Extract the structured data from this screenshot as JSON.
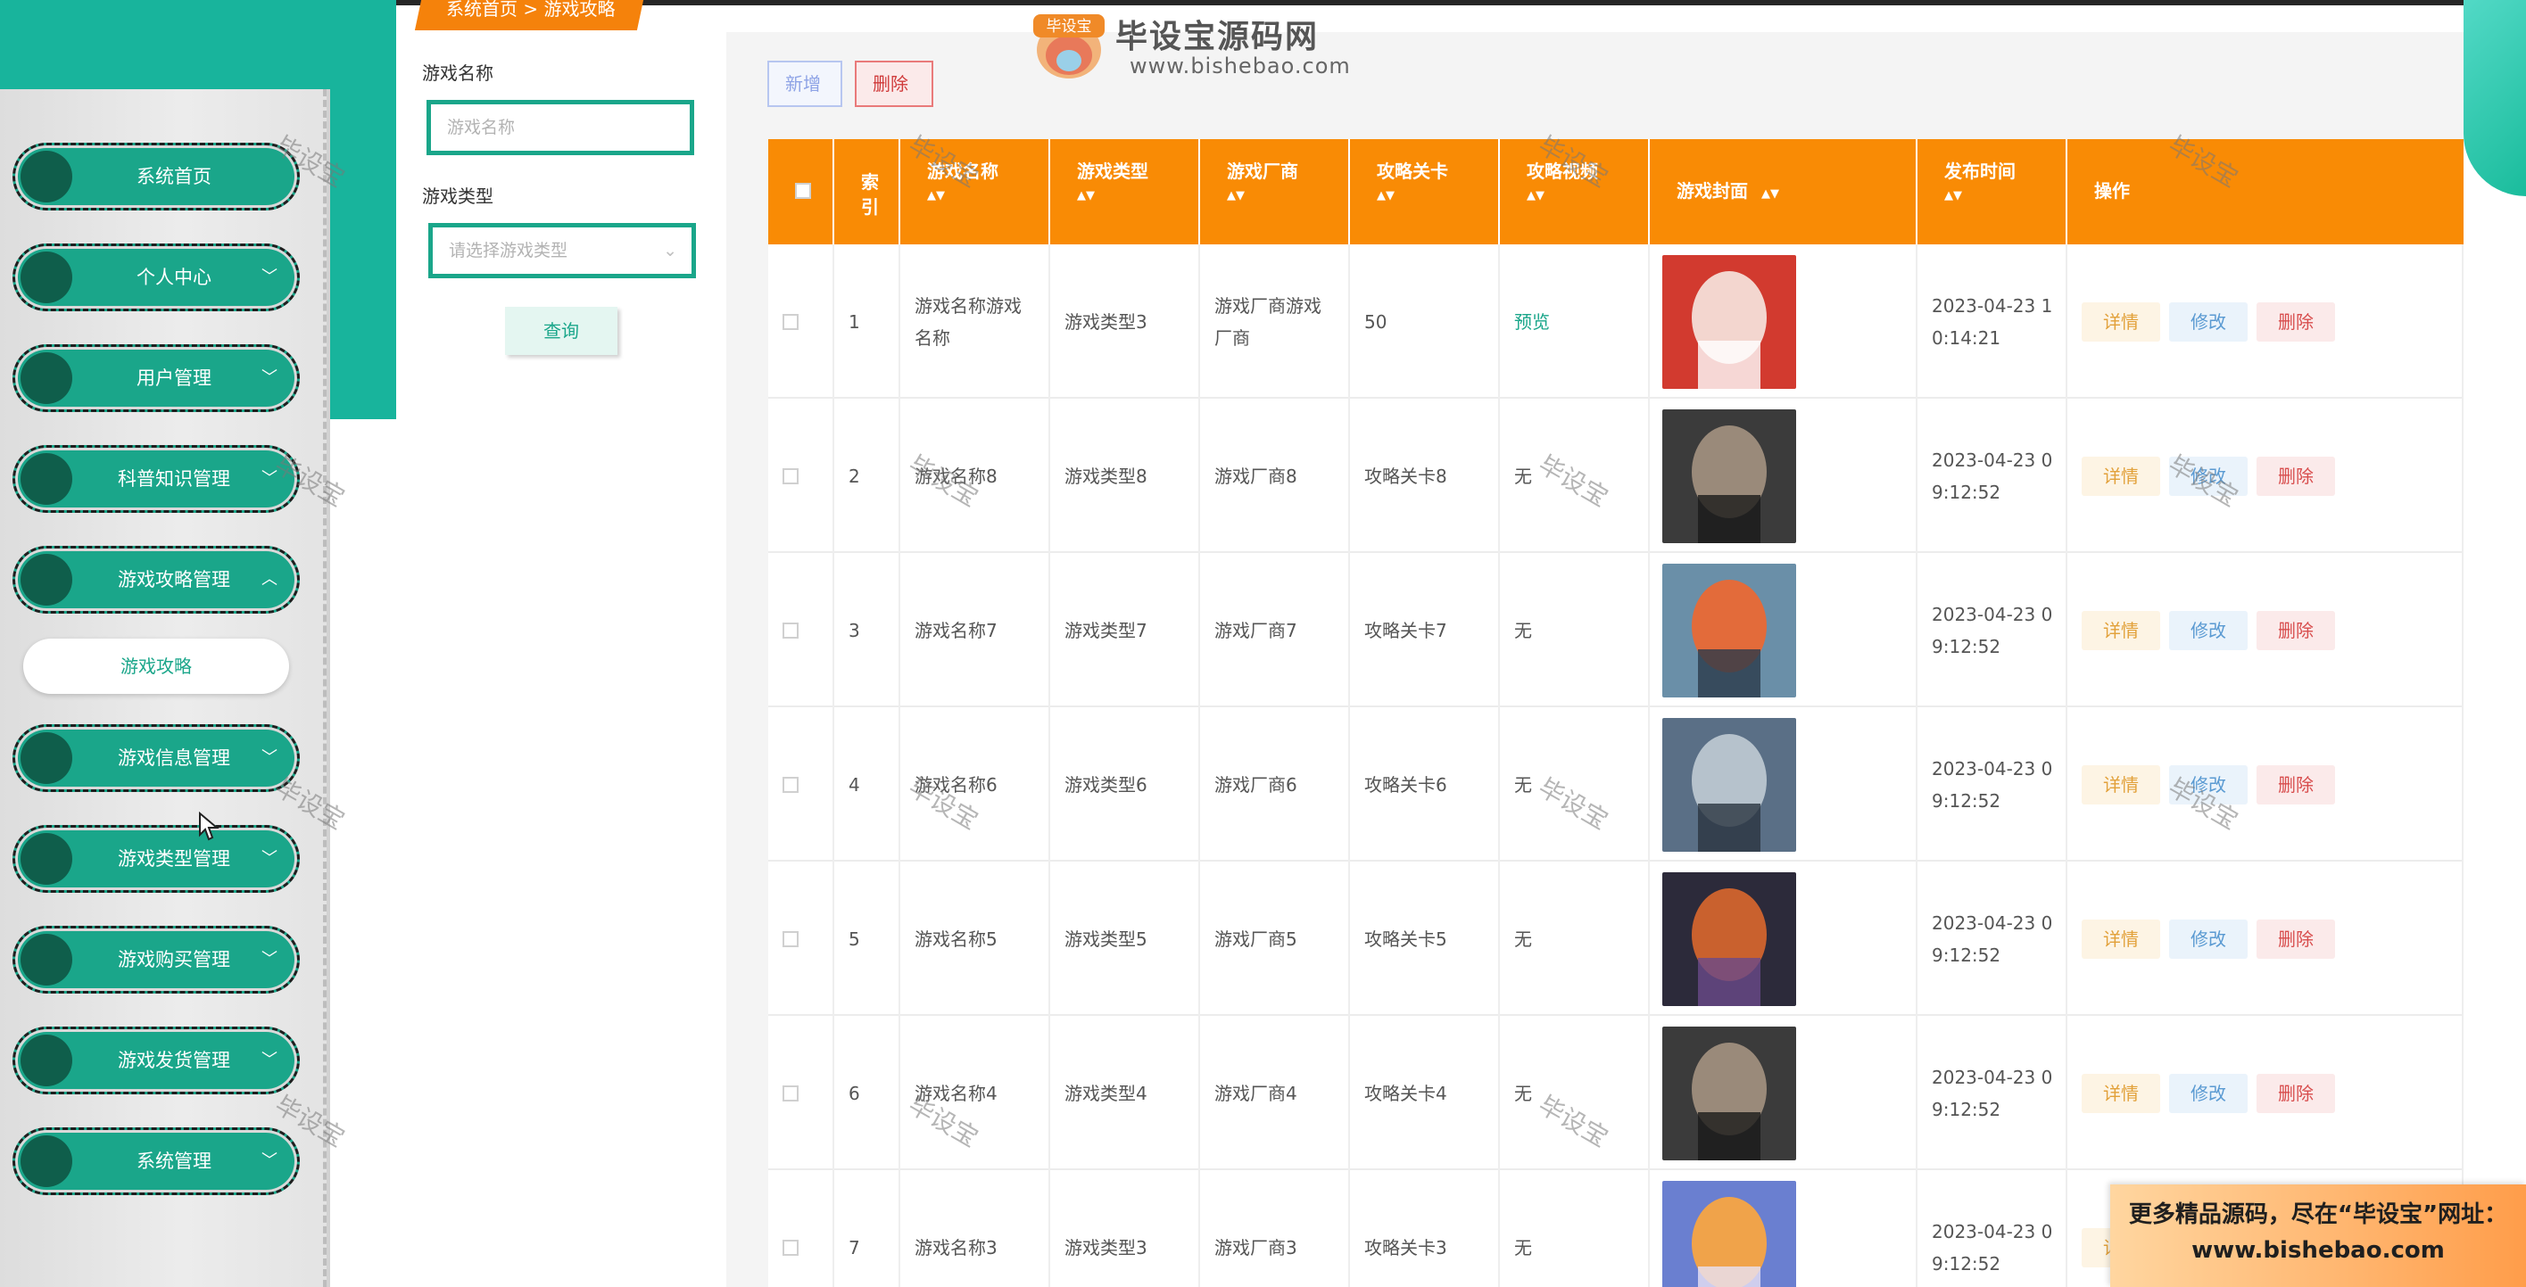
{
  "breadcrumb": "系统首页 > 游戏攻略",
  "logo": {
    "badge": "毕设宝",
    "title": "毕设宝源码网",
    "url": "www.bishebao.com"
  },
  "sidebar": {
    "items": [
      {
        "label": "系统首页",
        "chevron": ""
      },
      {
        "label": "个人中心",
        "chevron": "v"
      },
      {
        "label": "用户管理",
        "chevron": "v"
      },
      {
        "label": "科普知识管理",
        "chevron": "v"
      },
      {
        "label": "游戏攻略管理",
        "chevron": "^"
      },
      {
        "label": "游戏信息管理",
        "chevron": "v"
      },
      {
        "label": "游戏类型管理",
        "chevron": "v"
      },
      {
        "label": "游戏购买管理",
        "chevron": "v"
      },
      {
        "label": "游戏发货管理",
        "chevron": "v"
      },
      {
        "label": "系统管理",
        "chevron": "v"
      }
    ],
    "submenu": {
      "label": "游戏攻略"
    }
  },
  "search": {
    "name_label": "游戏名称",
    "name_placeholder": "游戏名称",
    "type_label": "游戏类型",
    "type_placeholder": "请选择游戏类型",
    "query_label": "查询"
  },
  "toolbar": {
    "add_label": "新增",
    "delete_label": "删除"
  },
  "table": {
    "headers": {
      "index": "索引",
      "name": "游戏名称",
      "type": "游戏类型",
      "vendor": "游戏厂商",
      "level": "攻略关卡",
      "video": "攻略视频",
      "cover": "游戏封面",
      "time": "发布时间",
      "ops": "操作"
    },
    "sort_arrows": "▲▼",
    "rows": [
      {
        "index": "1",
        "name": "游戏名称游戏名称",
        "type": "游戏类型3",
        "vendor": "游戏厂商游戏厂商",
        "level": "50",
        "video": "预览",
        "time": "2023-04-23 10:14:21"
      },
      {
        "index": "2",
        "name": "游戏名称8",
        "type": "游戏类型8",
        "vendor": "游戏厂商8",
        "level": "攻略关卡8",
        "video": "无",
        "time": "2023-04-23 09:12:52"
      },
      {
        "index": "3",
        "name": "游戏名称7",
        "type": "游戏类型7",
        "vendor": "游戏厂商7",
        "level": "攻略关卡7",
        "video": "无",
        "time": "2023-04-23 09:12:52"
      },
      {
        "index": "4",
        "name": "游戏名称6",
        "type": "游戏类型6",
        "vendor": "游戏厂商6",
        "level": "攻略关卡6",
        "video": "无",
        "time": "2023-04-23 09:12:52"
      },
      {
        "index": "5",
        "name": "游戏名称5",
        "type": "游戏类型5",
        "vendor": "游戏厂商5",
        "level": "攻略关卡5",
        "video": "无",
        "time": "2023-04-23 09:12:52"
      },
      {
        "index": "6",
        "name": "游戏名称4",
        "type": "游戏类型4",
        "vendor": "游戏厂商4",
        "level": "攻略关卡4",
        "video": "无",
        "time": "2023-04-23 09:12:52"
      },
      {
        "index": "7",
        "name": "游戏名称3",
        "type": "游戏类型3",
        "vendor": "游戏厂商3",
        "level": "攻略关卡3",
        "video": "无",
        "time": "2023-04-23 09:12:52"
      }
    ],
    "actions": {
      "detail": "详情",
      "edit": "修改",
      "delete": "删除"
    }
  },
  "watermark": "毕设宝",
  "promo": {
    "line1": "更多精品源码，尽在“毕设宝”网址：",
    "line2": "www.bishebao.com"
  },
  "colors": {
    "brand_teal": "#1aa68a",
    "header_orange": "#f98b05",
    "preview_link": "#1aa68a"
  }
}
